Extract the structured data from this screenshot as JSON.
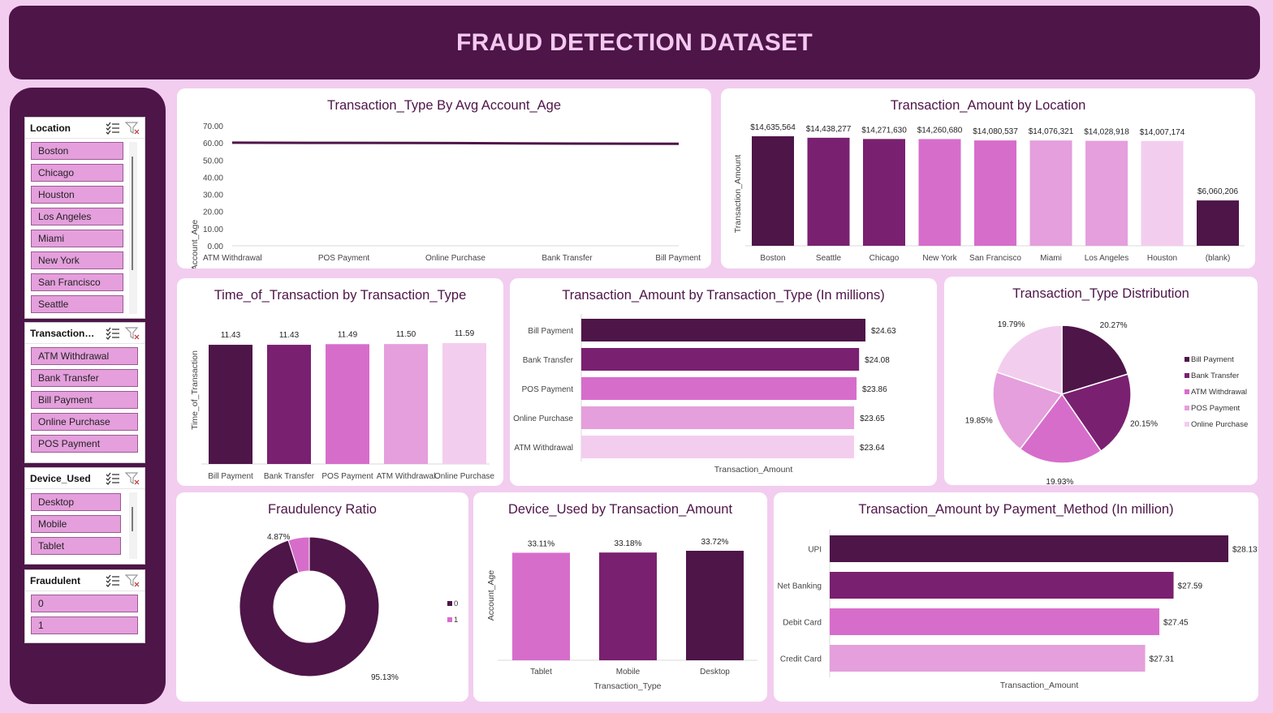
{
  "header": {
    "title": "FRAUD DETECTION DATASET"
  },
  "colors": {
    "dark": "#4e1548",
    "purple": "#7a2070",
    "magenta": "#d76dcb",
    "light": "#e49fdc",
    "pale": "#f3cdee",
    "background": "#f2cdef"
  },
  "slicers": {
    "location": {
      "title": "Location",
      "items": [
        "Boston",
        "Chicago",
        "Houston",
        "Los Angeles",
        "Miami",
        "New York",
        "San Francisco",
        "Seattle"
      ]
    },
    "transaction_type": {
      "title": "Transaction_T...",
      "items": [
        "ATM Withdrawal",
        "Bank Transfer",
        "Bill Payment",
        "Online Purchase",
        "POS Payment"
      ]
    },
    "device_used": {
      "title": "Device_Used",
      "items": [
        "Desktop",
        "Mobile",
        "Tablet"
      ]
    },
    "fraudulent": {
      "title": "Fraudulent",
      "items": [
        "0",
        "1"
      ]
    }
  },
  "chart_data": [
    {
      "id": "line",
      "type": "line",
      "title": "Transaction_Type By Avg Account_Age",
      "ylabel": "Account_Age",
      "xlabel": "",
      "categories": [
        "ATM Withdrawal",
        "POS Payment",
        "Online Purchase",
        "Bank Transfer",
        "Bill Payment"
      ],
      "values": [
        60.1,
        60.0,
        59.9,
        59.6,
        59.5
      ],
      "yticks": [
        "0.00",
        "10.00",
        "20.00",
        "30.00",
        "40.00",
        "50.00",
        "60.00",
        "70.00"
      ],
      "ylim": [
        0,
        70
      ]
    },
    {
      "id": "location",
      "type": "bar",
      "title": "Transaction_Amount by Location",
      "ylabel": "Transaction_Amount",
      "categories": [
        "Boston",
        "Seattle",
        "Chicago",
        "New York",
        "San Francisco",
        "Miami",
        "Los Angeles",
        "Houston",
        "(blank)"
      ],
      "values": [
        14635564,
        14438277,
        14271630,
        14260680,
        14080537,
        14076321,
        14028918,
        14007174,
        6060206
      ],
      "labels": [
        "$14,635,564",
        "$14,438,277",
        "$14,271,630",
        "$14,260,680",
        "$14,080,537",
        "$14,076,321",
        "$14,028,918",
        "$14,007,174",
        "$6,060,206"
      ]
    },
    {
      "id": "time",
      "type": "bar",
      "title": "Time_of_Transaction by Transaction_Type",
      "ylabel": "Time_of_Transaction",
      "categories": [
        "Bill Payment",
        "Bank Transfer",
        "POS Payment",
        "ATM Withdrawal",
        "Online Purchase"
      ],
      "values": [
        11.43,
        11.43,
        11.49,
        11.5,
        11.59
      ],
      "labels": [
        "11.43",
        "11.43",
        "11.49",
        "11.50",
        "11.59"
      ]
    },
    {
      "id": "amount_type",
      "type": "bar",
      "orientation": "horizontal",
      "title": "Transaction_Amount by Transaction_Type (In millions)",
      "xlabel": "Transaction_Amount",
      "categories": [
        "Bill Payment",
        "Bank Transfer",
        "POS Payment",
        "Online Purchase",
        "ATM Withdrawal"
      ],
      "values": [
        24.63,
        24.08,
        23.86,
        23.65,
        23.64
      ],
      "labels": [
        "$24.63",
        "$24.08",
        "$23.86",
        "$23.65",
        "$23.64"
      ]
    },
    {
      "id": "pie",
      "type": "pie",
      "title": "Transaction_Type Distribution",
      "categories": [
        "Bill Payment",
        "Bank Transfer",
        "ATM Withdrawal",
        "POS Payment",
        "Online Purchase"
      ],
      "values": [
        20.27,
        20.15,
        19.93,
        19.85,
        19.79
      ],
      "labels": [
        "20.27%",
        "20.15%",
        "19.93%",
        "19.85%",
        "19.79%"
      ],
      "legend": "right"
    },
    {
      "id": "donut",
      "type": "pie",
      "title": "Fraudulency Ratio",
      "categories": [
        "0",
        "1"
      ],
      "values": [
        95.13,
        4.87
      ],
      "labels": [
        "95.13%",
        "4.87%"
      ],
      "legend": "right"
    },
    {
      "id": "device",
      "type": "bar",
      "title": "Device_Used by Transaction_Amount",
      "ylabel": "Account_Age",
      "xlabel": "Transaction_Type",
      "categories": [
        "Tablet",
        "Mobile",
        "Desktop"
      ],
      "values": [
        33.11,
        33.18,
        33.72
      ],
      "labels": [
        "33.11%",
        "33.18%",
        "33.72%"
      ]
    },
    {
      "id": "payment",
      "type": "bar",
      "orientation": "horizontal",
      "title": "Transaction_Amount by Payment_Method (In million)",
      "xlabel": "Transaction_Amount",
      "categories": [
        "UPI",
        "Net Banking",
        "Debit Card",
        "Credit Card"
      ],
      "values": [
        28.13,
        27.59,
        27.45,
        27.31
      ],
      "labels": [
        "$28.13",
        "$27.59",
        "$27.45",
        "$27.31"
      ]
    }
  ]
}
